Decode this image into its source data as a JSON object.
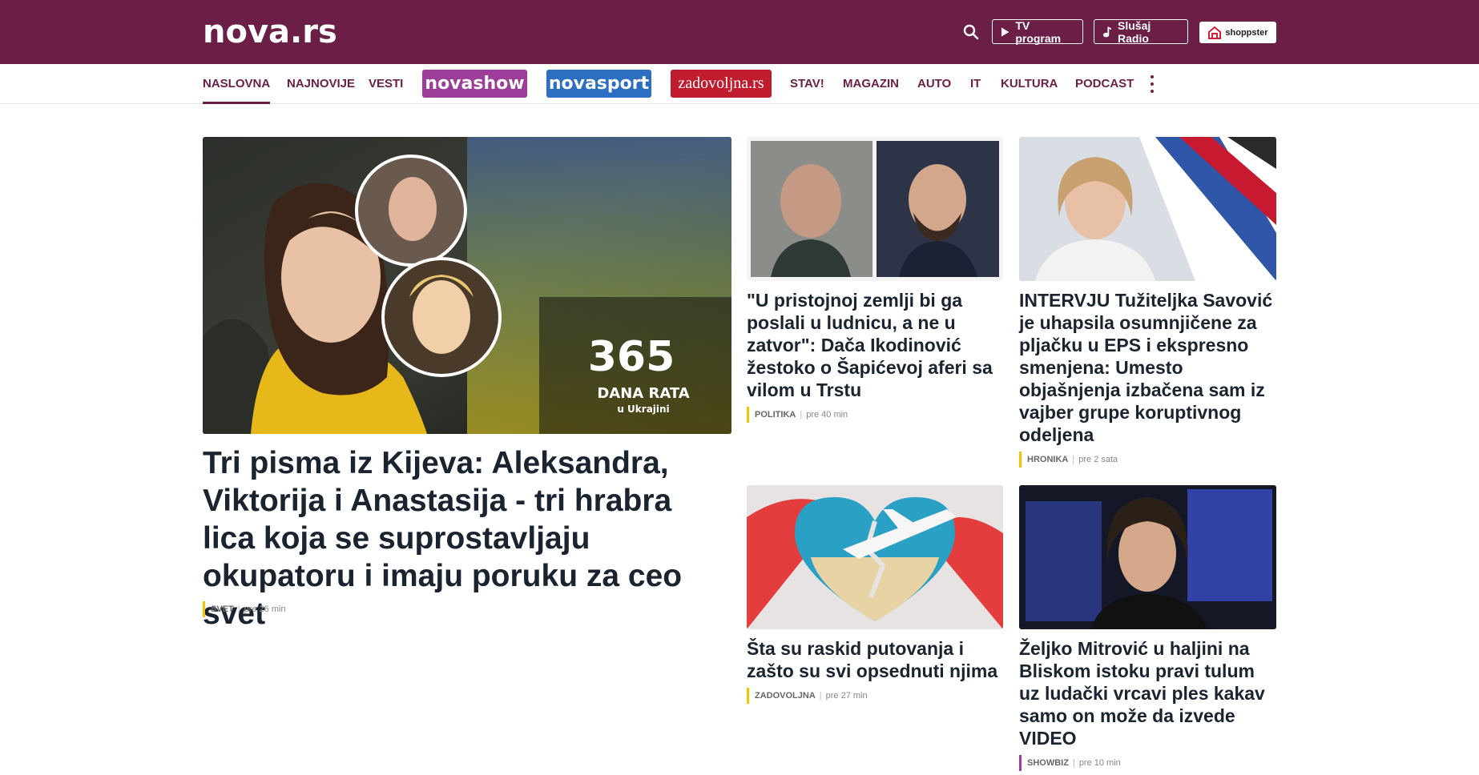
{
  "header": {
    "logo": "nova.rs",
    "tv_label": "TV program",
    "radio_label": "Slušaj Radio",
    "shop_label": "shoppster"
  },
  "nav": {
    "items": [
      "NASLOVNA",
      "NAJNOVIJE",
      "VESTI",
      "STAV!",
      "MAGAZIN",
      "AUTO",
      "IT",
      "KULTURA",
      "PODCAST"
    ],
    "active": "NASLOVNA",
    "brands": {
      "show": "novashow",
      "sport": "novasport",
      "zadovoljna": "zadovoljna.rs"
    }
  },
  "articles": [
    {
      "title": "Tri pisma iz Kijeva: Aleksandra, Viktorija i Anastasija - tri hrabra lica koja se suprostavljaju okupatoru i imaju poruku za ceo svet",
      "category": "SVET",
      "time": "pre 26 min",
      "image_overlay": {
        "number": "365",
        "line1": "DANA RATA",
        "line2": "u Ukrajini"
      }
    },
    {
      "title": "\"U pristojnoj zemlji bi ga poslali u ludnicu, a ne u zatvor\": Dača Ikodinović žestoko o Šapićevoj aferi sa vilom u Trstu",
      "category": "POLITIKA",
      "time": "pre 40 min"
    },
    {
      "title": "INTERVJU Tužiteljka Savović je uhapsila osumnjičene za pljačku u EPS i ekspresno smenjena: Umesto objašnjenja izbačena sam iz vajber grupe koruptivnog odeljena",
      "category": "HRONIKA",
      "time": "pre 2 sata"
    },
    {
      "title": "Šta su raskid putovanja i zašto su svi opsednuti njima",
      "category": "ZADOVOLJNA",
      "time": "pre 27 min"
    },
    {
      "title": "Željko Mitrović u haljini na Bliskom istoku pravi tulum uz ludački vrcavi ples kakav samo on može da izvede VIDEO",
      "category": "SHOWBIZ",
      "time": "pre 10 min"
    }
  ],
  "colors": {
    "brand": "#6b1f47",
    "accent_yellow": "#f2c500",
    "accent_showbiz": "#9c3d9a",
    "text": "#1a2330"
  },
  "icons": [
    "search-icon",
    "play-icon",
    "music-note-icon",
    "shoppster-logo-icon",
    "more-vertical-icon"
  ]
}
